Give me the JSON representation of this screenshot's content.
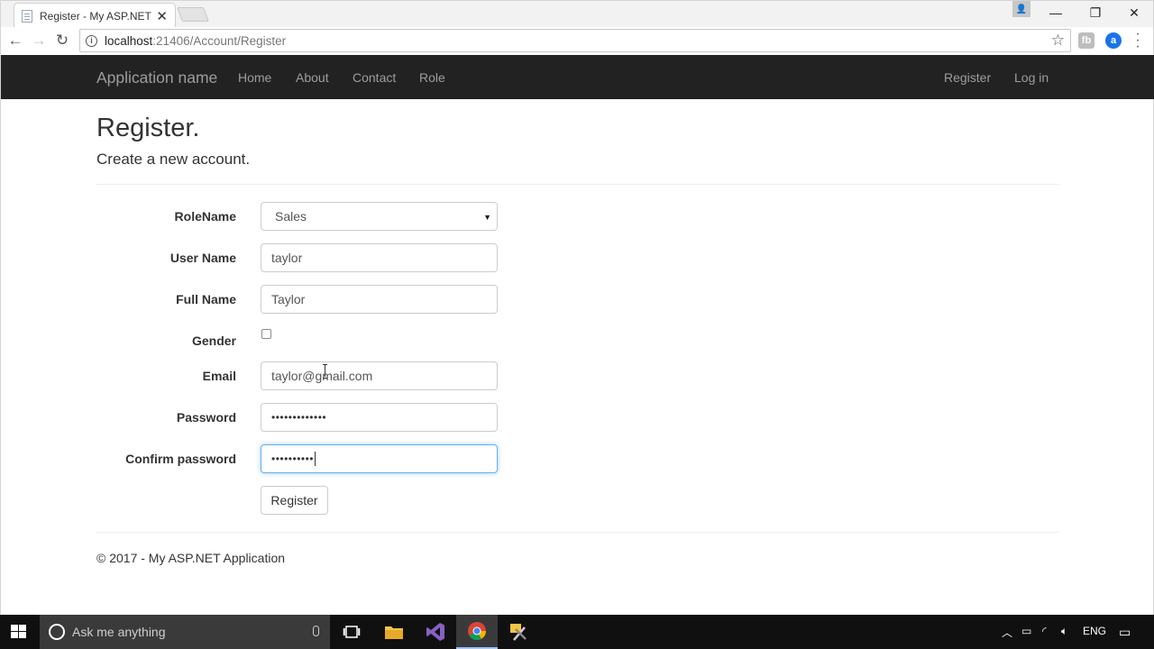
{
  "browser": {
    "tab_title": "Register - My ASP.NET A",
    "url_host": "localhost",
    "url_path": ":21406/Account/Register"
  },
  "navbar": {
    "brand": "Application name",
    "links": [
      "Home",
      "About",
      "Contact",
      "Role"
    ],
    "right_links": [
      "Register",
      "Log in"
    ]
  },
  "page": {
    "title": "Register.",
    "subtitle": "Create a new account."
  },
  "form": {
    "role_label": "RoleName",
    "role_value": "Sales",
    "username_label": "User Name",
    "username_value": "taylor",
    "fullname_label": "Full Name",
    "fullname_value": "Taylor",
    "gender_label": "Gender",
    "gender_checked": false,
    "email_label": "Email",
    "email_value": "taylor@gmail.com",
    "password_label": "Password",
    "password_mask": "•••••••••••••",
    "confirm_label": "Confirm password",
    "confirm_mask": "••••••••••",
    "submit_label": "Register"
  },
  "footer": {
    "text": "© 2017 - My ASP.NET Application"
  },
  "taskbar": {
    "search_placeholder": "Ask me anything",
    "language": "ENG"
  },
  "colors": {
    "navbar_bg": "#222222",
    "nav_text": "#9d9d9d",
    "focus_border": "#66afe9"
  }
}
